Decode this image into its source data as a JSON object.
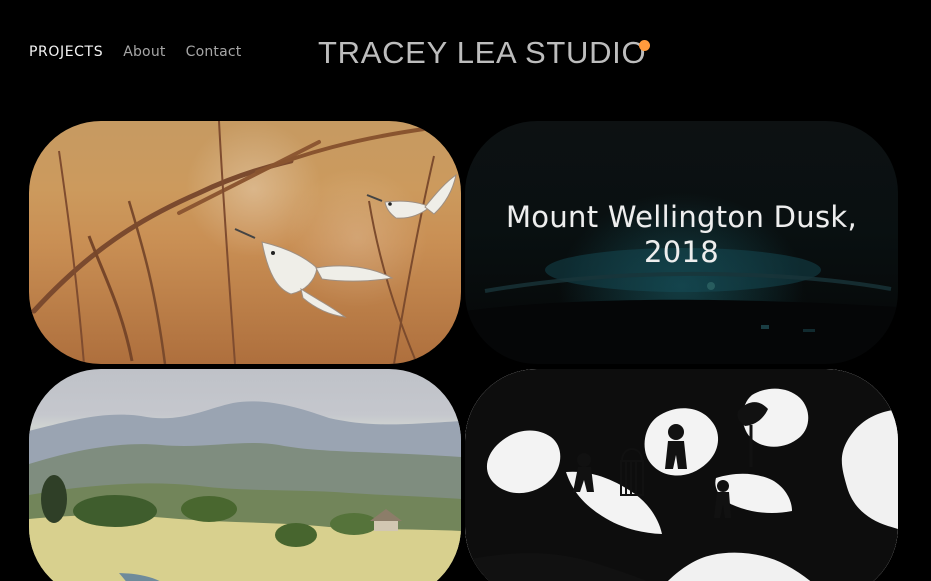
{
  "nav": {
    "items": [
      {
        "label": "PROJECTS",
        "active": true
      },
      {
        "label": "About",
        "active": false
      },
      {
        "label": "Contact",
        "active": false
      }
    ]
  },
  "brand": {
    "logo_text": "TRACEY LEA STUDIO",
    "accent_color": "#ff9a3d"
  },
  "projects": [
    {
      "kind": "birds-branches",
      "overlay_title": ""
    },
    {
      "kind": "dark-mountain-view",
      "overlay_title": "Mount Wellington Dusk, 2018"
    },
    {
      "kind": "landscape-painting",
      "overlay_title": ""
    },
    {
      "kind": "silhouette-collage",
      "overlay_title": ""
    }
  ]
}
